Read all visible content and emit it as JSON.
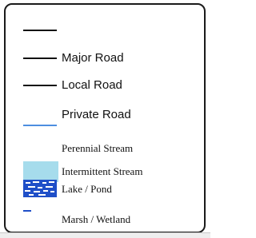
{
  "legend": {
    "items": [
      {
        "label": "",
        "symbol": "line",
        "color": "#111111"
      },
      {
        "label": "Major Road",
        "symbol": "line",
        "color": "#111111"
      },
      {
        "label": "Local Road",
        "symbol": "line",
        "color": "#111111"
      },
      {
        "label": "Private Road",
        "symbol": "line",
        "color": "#4d8ee0"
      },
      {
        "label": "Perennial Stream",
        "symbol": "none"
      },
      {
        "label": "Intermittent Stream",
        "symbol": "fill",
        "color": "#a6dcec"
      },
      {
        "label": "Lake / Pond",
        "symbol": "hatched-fill",
        "color": "#1f4fc8"
      },
      {
        "label": "Marsh / Wetland",
        "symbol": "line",
        "color": "#1f4fc8"
      }
    ]
  }
}
